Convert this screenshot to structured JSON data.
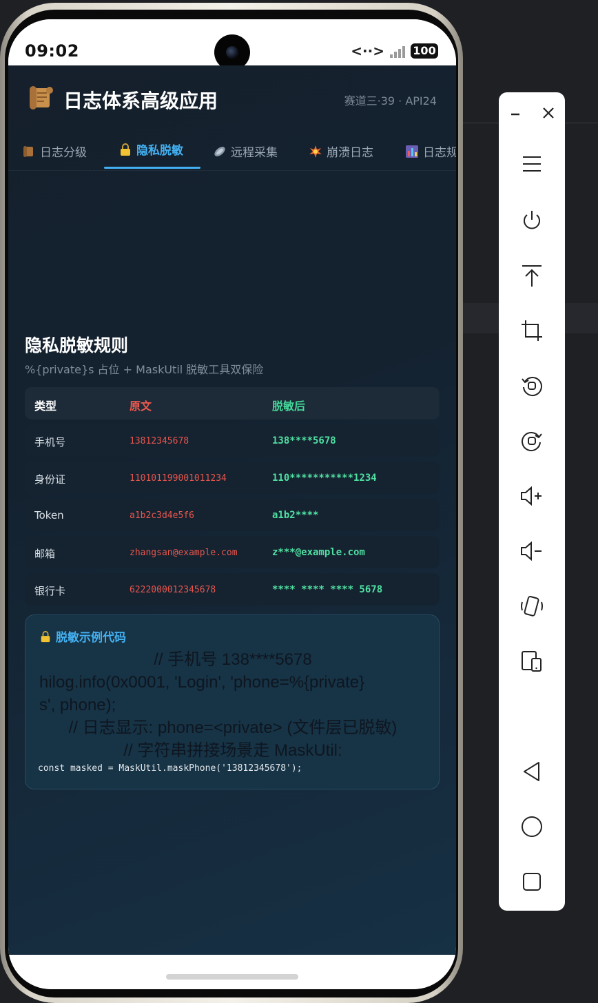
{
  "status_bar": {
    "time": "09:02",
    "network_arrows": "<··>",
    "battery": "100"
  },
  "header": {
    "title": "日志体系高级应用",
    "meta": "赛道三·39 · API24",
    "icon": "scroll-icon"
  },
  "tabs": [
    {
      "label": "日志分级",
      "icon": "log-scroll-icon",
      "active": false
    },
    {
      "label": "隐私脱敏",
      "icon": "lock-icon",
      "active": true
    },
    {
      "label": "远程采集",
      "icon": "satellite-icon",
      "active": false
    },
    {
      "label": "崩溃日志",
      "icon": "explosion-icon",
      "active": false
    },
    {
      "label": "日志规",
      "icon": "chart-icon",
      "active": false
    }
  ],
  "section": {
    "title": "隐私脱敏规则",
    "subtitle": "%{private}s 占位 + MaskUtil 脱敏工具双保险"
  },
  "table": {
    "headers": [
      "类型",
      "原文",
      "脱敏后"
    ],
    "rows": [
      {
        "type": "手机号",
        "original": "13812345678",
        "masked": "138****5678"
      },
      {
        "type": "身份证",
        "original": "110101199001011234",
        "masked": "110***********1234"
      },
      {
        "type": "Token",
        "original": "a1b2c3d4e5f6",
        "masked": "a1b2****"
      },
      {
        "type": "邮箱",
        "original": "zhangsan@example.com",
        "masked": "z***@example.com"
      },
      {
        "type": "银行卡",
        "original": "6222000012345678",
        "masked": "**** **** **** 5678"
      }
    ]
  },
  "code": {
    "title": "脱敏示例代码",
    "lines_large": [
      "// 手机号 138****5678",
      "hilog.info(0x0001, 'Login', 'phone=%{private}",
      "s', phone);",
      "// 日志显示: phone=<private> (文件层已脱敏)",
      "// 字符串拼接场景走 MaskUtil:"
    ],
    "line_small": "const masked = MaskUtil.maskPhone('13812345678');"
  },
  "colors": {
    "accent": "#43b0f1",
    "original_red": "#e8554c",
    "masked_green": "#4fe0a1"
  },
  "toolbar": {
    "buttons": [
      "minimize-icon",
      "close-icon",
      "menu-icon",
      "power-icon",
      "pin-top-icon",
      "crop-icon",
      "rotate-left-icon",
      "rotate-right-icon",
      "volume-up-icon",
      "volume-down-icon",
      "shake-icon",
      "screen-fold-icon",
      "back-icon",
      "home-icon",
      "recents-icon"
    ]
  }
}
